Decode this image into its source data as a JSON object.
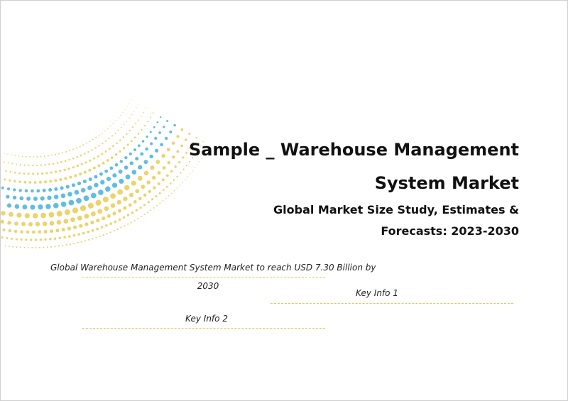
{
  "cover": {
    "title_line1": "Sample _ Warehouse Management",
    "title_line2": "System Market",
    "subtitle_line1": "Global Market Size Study, Estimates &",
    "subtitle_line2": "Forecasts: 2023-2030"
  },
  "info": {
    "headline_line1": "Global Warehouse Management System Market to reach USD 7.30 Billion by",
    "headline_line2": "2030",
    "key_info_1": "Key Info 1",
    "key_info_2": "Key Info 2"
  },
  "colors": {
    "accent_blue": "#5fbde3",
    "accent_yellow": "#ecd36a",
    "divider": "#e2c45c",
    "border": "#cfcfcf"
  }
}
